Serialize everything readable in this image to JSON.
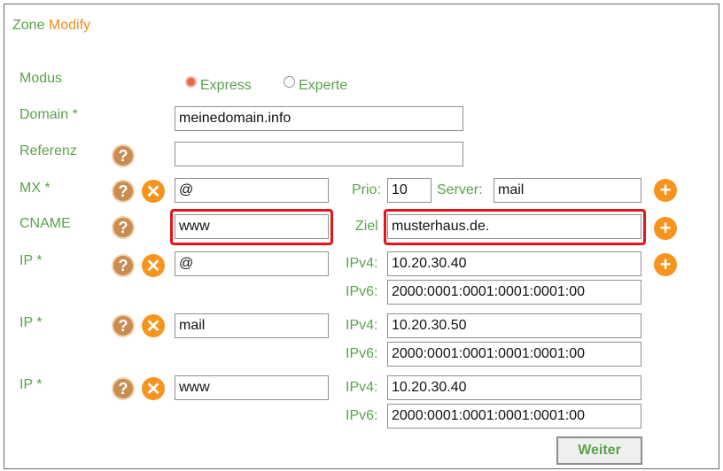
{
  "header": {
    "title_part1": "Zone",
    "title_part2": "Modify"
  },
  "modus": {
    "label": "Modus",
    "option_express": "Express",
    "option_experte": "Experte",
    "selected": "Express"
  },
  "domain": {
    "label": "Domain *",
    "value": "meinedomain.info"
  },
  "referenz": {
    "label": "Referenz",
    "value": ""
  },
  "mx": {
    "label": "MX *",
    "host": "@",
    "prio_label": "Prio:",
    "prio": "10",
    "server_label": "Server:",
    "server": "mail"
  },
  "cname": {
    "label": "CNAME",
    "host": "www",
    "ziel_label": "Ziel",
    "ziel": "musterhaus.de."
  },
  "ip_rows": [
    {
      "label": "IP *",
      "host": "@",
      "ipv4_label": "IPv4:",
      "ipv4": "10.20.30.40",
      "ipv6_label": "IPv6:",
      "ipv6": "2000:0001:0001:0001:0001:00"
    },
    {
      "label": "IP *",
      "host": "mail",
      "ipv4_label": "IPv4:",
      "ipv4": "10.20.30.50",
      "ipv6_label": "IPv6:",
      "ipv6": "2000:0001:0001:0001:0001:00"
    },
    {
      "label": "IP *",
      "host": "www",
      "ipv4_label": "IPv4:",
      "ipv4": "10.20.30.40",
      "ipv6_label": "IPv6:",
      "ipv6": "2000:0001:0001:0001:0001:00"
    }
  ],
  "icons": {
    "help": "?",
    "delete": "✕",
    "add": "+"
  },
  "buttons": {
    "weiter": "Weiter"
  },
  "colors": {
    "green": "#5aa24a",
    "orange": "#f7941d",
    "highlight": "#e5141a"
  }
}
